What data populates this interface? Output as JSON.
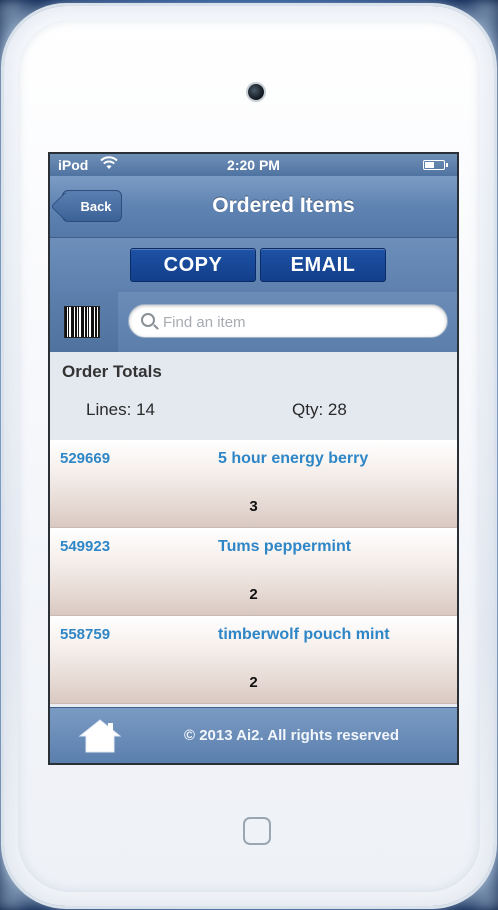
{
  "statusbar": {
    "carrier": "iPod",
    "time": "2:20 PM"
  },
  "navbar": {
    "back_label": "Back",
    "title": "Ordered Items"
  },
  "actions": {
    "copy_label": "COPY",
    "email_label": "EMAIL"
  },
  "search": {
    "placeholder": "Find an item",
    "value": ""
  },
  "totals": {
    "title": "Order Totals",
    "lines_text": "Lines: 14",
    "qty_text": "Qty: 28",
    "lines": 14,
    "qty": 28
  },
  "items": [
    {
      "code": "529669",
      "name": "5 hour energy berry",
      "qty": "3"
    },
    {
      "code": "549923",
      "name": "Tums peppermint",
      "qty": "2"
    },
    {
      "code": "558759",
      "name": "timberwolf pouch mint",
      "qty": "2"
    }
  ],
  "footer": {
    "copyright": "© 2013 Ai2. All rights reserved"
  },
  "icons": {
    "wifi": "wifi-icon",
    "battery": "battery-icon",
    "barcode": "barcode-icon",
    "search": "search-icon",
    "home": "home-icon"
  },
  "colors": {
    "accent": "#2f86c6",
    "button": "#1e52a6",
    "bar": "#5f83b2"
  }
}
